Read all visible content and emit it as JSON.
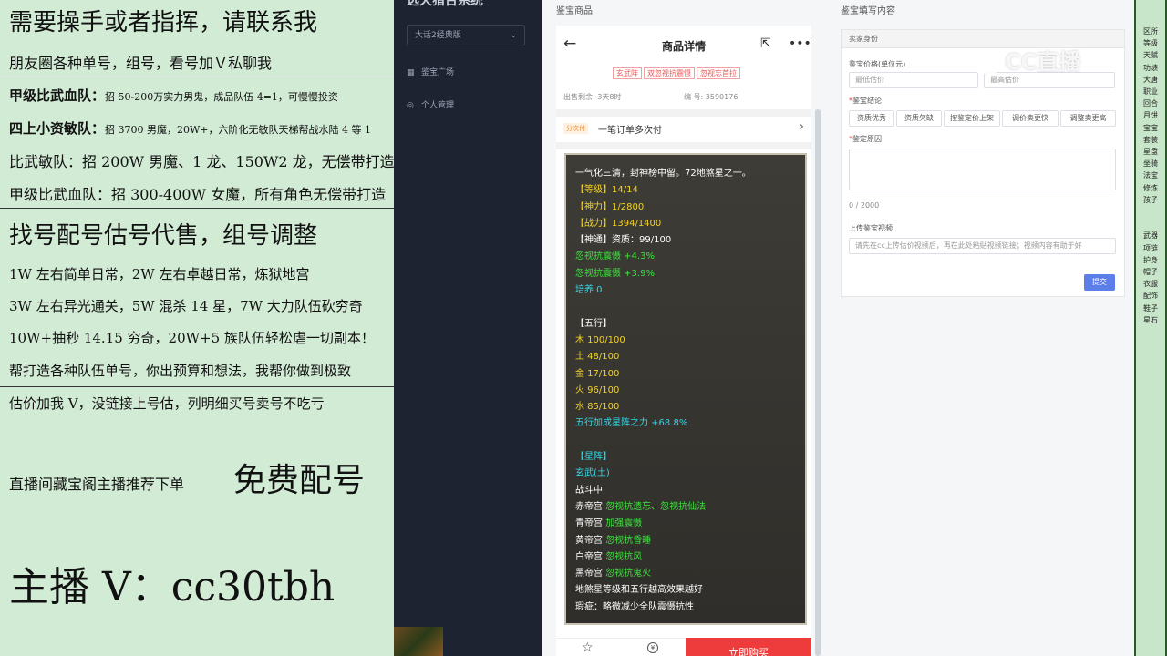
{
  "overlay": {
    "lines": [
      "需要操手或者指挥，请联系我",
      "朋友圈各种单号，组号，看号加Ｖ私聊我",
      "甲级比武血队：",
      "招 50-200万实力男鬼，成品队伍 4=1，可慢慢投资",
      "四上小资敏队：",
      "招 3700 男魔，20W+，六阶化无敏队天梯帮战水陆 4 等 1",
      "比武敏队：招 200W 男魔、1 龙、150W2 龙，无偿带打造",
      "甲级比武血队：招 300-400W 女魔，所有角色无偿带打造",
      "找号配号估号代售，组号调整",
      "1W 左右简单日常，2W 左右卓越日常，炼狱地宫",
      "3W 左右异光通关，5W 混杀 14 星，7W 大力队伍砍穷奇",
      "10W+抽秒 14.15 穷奇，20W+5 族队伍轻松虐一切副本！",
      "帮打造各种队伍单号，你出预算和想法，我帮你做到极致",
      "估价加我 V，没链接上号估，列明细买号卖号不吃亏",
      "直播间藏宝阁主播推荐下单",
      "免费配号",
      "主播 V：cc30tbh"
    ]
  },
  "sidebar": {
    "logo": "选天猎台系统",
    "server_select": "大话2经典版",
    "nav_items": [
      "鉴宝广场",
      "个人管理"
    ]
  },
  "center": {
    "section_title": "鉴宝商品",
    "header_title": "商品详情",
    "tags": [
      "玄武阵",
      "双忽视抗震慑",
      "忽视忘首拉"
    ],
    "sale_remaining": "出售剩余: 3天8时",
    "item_no": "编 号: 3590176",
    "pay_badge": "分次付",
    "pay_text": "一笔订单多次付",
    "card_lines": [
      {
        "t": "一气化三清，封神榜中留。72地煞星之一。",
        "c": "white"
      },
      {
        "t": "【等级】14/14",
        "c": "yellow"
      },
      {
        "t": "【神力】1/2800",
        "c": "yellow"
      },
      {
        "t": "【战力】1394/1400",
        "c": "yellow"
      },
      {
        "t": "【神通】资质：99/100",
        "c": "white"
      },
      {
        "t": "忽视抗震慑 +4.3%",
        "c": "green"
      },
      {
        "t": "忽视抗震慑 +3.9%",
        "c": "green"
      },
      {
        "t": "培养 0",
        "c": "cyan"
      },
      {
        "t": "",
        "c": "white"
      },
      {
        "t": "【五行】",
        "c": "white"
      },
      {
        "t": "木 100/100",
        "c": "yellow"
      },
      {
        "t": "土 48/100",
        "c": "yellow"
      },
      {
        "t": "金 17/100",
        "c": "yellow"
      },
      {
        "t": "火 96/100",
        "c": "yellow"
      },
      {
        "t": "水 85/100",
        "c": "yellow"
      },
      {
        "t": "五行加成星阵之力 +68.8%",
        "c": "cyan"
      },
      {
        "t": "",
        "c": "white"
      },
      {
        "t": "【星阵】",
        "c": "cyan"
      },
      {
        "t": "玄武(土)",
        "c": "cyan"
      },
      {
        "t": "战斗中",
        "c": "white"
      }
    ],
    "palaces": [
      {
        "name": "赤帝宫",
        "effect": "忽视抗遗忘、忽视抗仙法"
      },
      {
        "name": "青帝宫",
        "effect": "加强震慑"
      },
      {
        "name": "黄帝宫",
        "effect": "忽视抗昏睡"
      },
      {
        "name": "白帝宫",
        "effect": "忽视抗风"
      },
      {
        "name": "黑帝宫",
        "effect": "忽视抗鬼火"
      }
    ],
    "card_tail": [
      "地煞星等级和五行越高效果越好",
      "瑕疵：略微减少全队震慑抗性"
    ],
    "buy_button": "立即购买"
  },
  "right": {
    "section_title": "鉴宝填写内容",
    "panel_header": "卖家身份",
    "price_label": "鉴宝价格(单位元)",
    "min_placeholder": "最低估价",
    "max_placeholder": "最高估价",
    "conclusion_label": "鉴宝结论",
    "options": [
      "资质优秀",
      "资质欠缺",
      "按鉴定价上架",
      "调价卖更快",
      "调整卖更高"
    ],
    "reason_label": "鉴定原因",
    "counter": "0 / 2000",
    "video_label": "上传鉴宝视频",
    "video_placeholder": "请先在cc上传估价视频后，再在此处粘贴视频链接；视频内容有助于好",
    "submit": "提交"
  },
  "watermark": "CC直播",
  "strip": {
    "rows": [
      "区所",
      "等级",
      "天赋",
      "功绩",
      "大唐",
      "职业",
      "回合",
      "月饼",
      "宝宝",
      "套装",
      "星盘",
      "坐骑",
      "法宝",
      "修炼",
      "孩子",
      "",
      "",
      "武器",
      "项链",
      "护身",
      "帽子",
      "衣服",
      "配饰",
      "鞋子",
      "星石"
    ]
  }
}
